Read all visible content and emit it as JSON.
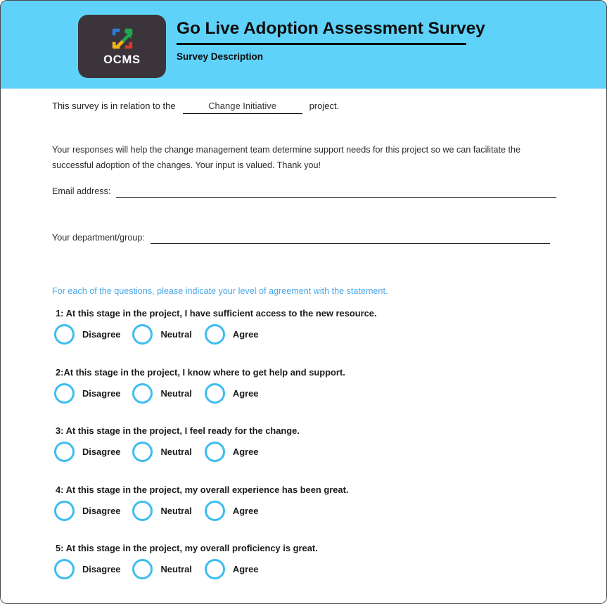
{
  "colors": {
    "header_band": "#5FD2FA",
    "logo_tile": "#3B353B",
    "radio_outline": "#3EBDF0",
    "instruction_text": "#4AA8E8",
    "body_text": "#2b2b2b"
  },
  "header": {
    "logo_word": "OCMS",
    "logo_icon": "expand-arrow-square-icon",
    "title": "Go Live Adoption Assessment Survey",
    "subtitle": "Survey Description"
  },
  "intro": {
    "before": "This survey is in relation to the",
    "project_name": "Change Initiative",
    "after": "project."
  },
  "paragraph": "Your responses will help the change management team determine support needs for this project so we can facilitate the successful adoption of the changes. Your input is valued. Thank you!",
  "fields": [
    {
      "label": "Email address:",
      "value": "",
      "placeholder": ""
    },
    {
      "label": "Your department/group:",
      "value": "",
      "placeholder": ""
    }
  ],
  "instruction": "For each of the questions, please indicate your level of agreement with the statement.",
  "options": {
    "disagree": "Disagree",
    "neutral": "Neutral",
    "agree": "Agree"
  },
  "questions": [
    {
      "text": "1: At this stage in the project, I have sufficient access to the new resource."
    },
    {
      "text": "2:At this stage in the project, I know where to get help and support."
    },
    {
      "text": "3: At this stage in the project, I feel ready for the change."
    },
    {
      "text": "4: At this stage in the project, my overall experience has been great."
    },
    {
      "text": "5: At this stage in the project, my overall proficiency is great."
    }
  ]
}
